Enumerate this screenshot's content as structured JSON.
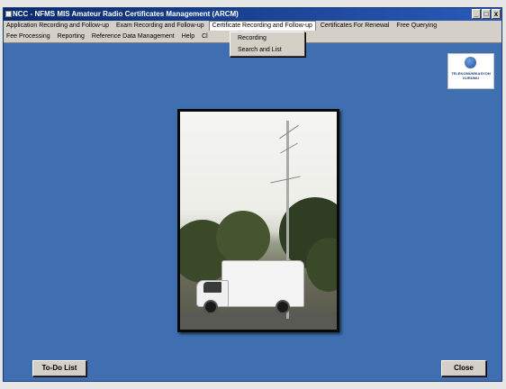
{
  "window": {
    "title": "NCC - NFMS MIS Amateur Radio Certificates Management (ARCM)",
    "controls": {
      "minimize": "_",
      "maximize": "□",
      "close": "x"
    }
  },
  "menubar": {
    "row1": [
      "Application Recording and Follow-up",
      "Exam Recording and Follow-up",
      "Certificate Recording and Follow-up",
      "Certificates For Renewal",
      "Free Querying"
    ],
    "row2": [
      "Fee Processing",
      "Reporting",
      "Reference Data Management",
      "Help",
      "Cl"
    ]
  },
  "dropdown": {
    "items": [
      "Recording",
      "Search and List"
    ]
  },
  "logo": {
    "text": "TELEKOMÜNİKASYON KURUMU"
  },
  "buttons": {
    "todo": "To-Do List",
    "close": "Close"
  },
  "colors": {
    "background": "#3f6fb0",
    "titlebar": "#0a2a6e",
    "menubar": "#d4d0c8"
  }
}
